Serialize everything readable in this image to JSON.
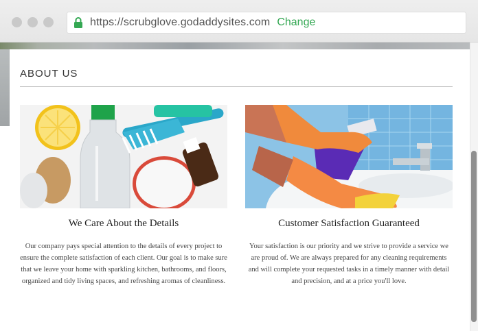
{
  "browser": {
    "url": "https://scrubglove.godaddysites.com",
    "change_label": "Change",
    "url_color": "#555555",
    "change_color": "#34a853"
  },
  "section": {
    "title": "ABOUT US"
  },
  "cards": [
    {
      "title": "We Care About the Details",
      "text": "Our company pays special attention to the details of every project to ensure the complete satisfaction of each client. Our goal is to make sure that we leave your home with sparkling kitchen, bathrooms, and floors, organized and tidy living spaces, and refreshing aromas of cleanliness."
    },
    {
      "title": "Customer Satisfaction Guaranteed",
      "text": "Your satisfaction is our priority and we strive to provide a service we are proud of. We are always prepared for any cleaning requirements and will complete your requested tasks in a timely manner with detail and precision, and at a price you'll love."
    }
  ],
  "icons": [
    "lock-icon",
    "window-dot-icon"
  ]
}
